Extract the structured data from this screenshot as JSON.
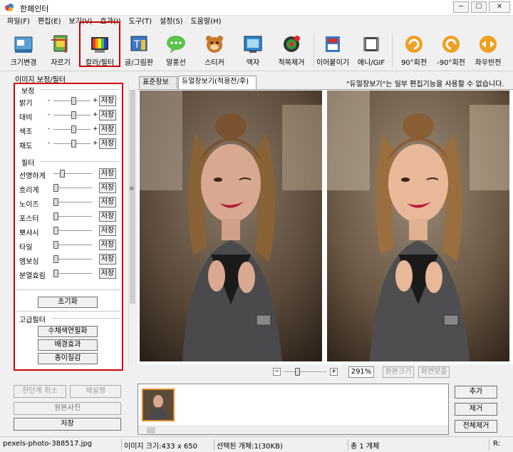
{
  "window": {
    "title": "한페인터"
  },
  "menu": [
    "파일(F)",
    "편집(E)",
    "보기(V)",
    "효과(I)",
    "도구(T)",
    "설정(S)",
    "도움말(H)"
  ],
  "toolbar": [
    {
      "label": "크기변경",
      "icon": "resize-icon"
    },
    {
      "label": "자르기",
      "icon": "crop-icon"
    },
    {
      "label": "칼라/필터",
      "icon": "color-filter-icon"
    },
    {
      "label": "글/그림판",
      "icon": "text-paint-icon"
    },
    {
      "label": "말풍선",
      "icon": "speech-bubble-icon"
    },
    {
      "label": "스티커",
      "icon": "sticker-icon"
    },
    {
      "label": "액자",
      "icon": "frame-icon"
    },
    {
      "label": "적목제거",
      "icon": "redeye-icon"
    },
    {
      "label": "이어붙이기",
      "icon": "join-icon"
    },
    {
      "label": "애니/GIF",
      "icon": "gif-icon"
    },
    {
      "label": "90°회전",
      "icon": "rotate-right-icon"
    },
    {
      "label": "-90°회전",
      "icon": "rotate-left-icon"
    },
    {
      "label": "좌우반전",
      "icon": "flip-icon"
    }
  ],
  "panel": {
    "title": "이미지 보정/필터",
    "correction_title": "보정",
    "correction": [
      {
        "label": "밝기",
        "value": 0.55
      },
      {
        "label": "대비",
        "value": 0.55
      },
      {
        "label": "색조",
        "value": 0.55
      },
      {
        "label": "채도",
        "value": 0.55
      }
    ],
    "filter_title": "필터",
    "filters": [
      {
        "label": "선명하게",
        "value": 0.2
      },
      {
        "label": "흐리게",
        "value": 0.0
      },
      {
        "label": "노이즈",
        "value": 0.0
      },
      {
        "label": "포스터",
        "value": 0.0
      },
      {
        "label": "뽀샤시",
        "value": 0.0
      },
      {
        "label": "타일",
        "value": 0.0
      },
      {
        "label": "엠보싱",
        "value": 0.0
      },
      {
        "label": "분열효림",
        "value": 0.0
      }
    ],
    "save_label": "저장",
    "reset_label": "초기화",
    "advanced_title": "고급필터",
    "advanced": [
      "수채색연필화",
      "배경효과",
      "종이질감"
    ]
  },
  "tabs": [
    "표준창보기",
    "듀얼창보기(적용전/후)"
  ],
  "notice": "\"듀얼창보기\"는 일부 편집기능을 사용할 수 없습니다.",
  "zoom": {
    "level": "291%",
    "original_size": "원본크기",
    "fit_screen": "화면맞춤",
    "value": 0.3
  },
  "left_actions": {
    "undo": "한단계 취소",
    "redo": "재실행",
    "original": "원본사진",
    "save": "저장"
  },
  "right_actions": [
    "추가",
    "제거",
    "전체제거"
  ],
  "status": {
    "filename": "pexels-photo-388517.jpg",
    "image_size": "이미지 크기:433 x 650",
    "selected": "선택된 개체:1(30KB)",
    "total": "총 1 개체",
    "corner": "R:"
  }
}
